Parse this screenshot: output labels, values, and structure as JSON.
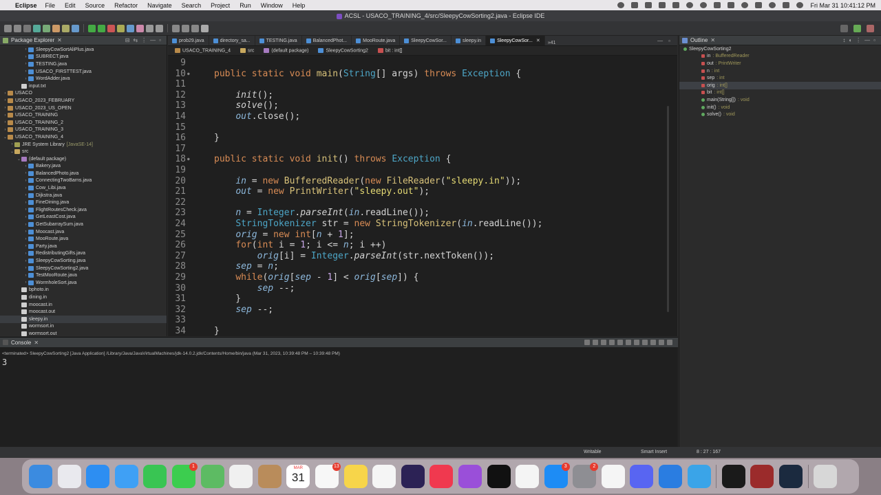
{
  "menubar": {
    "app_name": "Eclipse",
    "items": [
      "File",
      "Edit",
      "Source",
      "Refactor",
      "Navigate",
      "Search",
      "Project",
      "Run",
      "Window",
      "Help"
    ],
    "clock": "Fri Mar 31  10:41:12 PM"
  },
  "window": {
    "title": "ACSL - USACO_TRAINING_4/src/SleepyCowSorting2.java - Eclipse IDE"
  },
  "package_explorer": {
    "tab_label": "Package Explorer",
    "rows": [
      {
        "label": "SleepyCowSortAliPlus.java",
        "indent": 3,
        "icon": "java",
        "twisty": "›"
      },
      {
        "label": "SUBRECT.java",
        "indent": 3,
        "icon": "java",
        "twisty": "›"
      },
      {
        "label": "TESTING.java",
        "indent": 3,
        "icon": "java",
        "twisty": "›"
      },
      {
        "label": "USACO_FIRSTTEST.java",
        "indent": 3,
        "icon": "java",
        "twisty": "›"
      },
      {
        "label": "WordAdder.java",
        "indent": 3,
        "icon": "java",
        "twisty": "›"
      },
      {
        "label": "input.txt",
        "indent": 2,
        "icon": "file",
        "twisty": ""
      },
      {
        "label": "USACO",
        "indent": 0,
        "icon": "proj",
        "twisty": "›"
      },
      {
        "label": "USACO_2023_FEBRUARY",
        "indent": 0,
        "icon": "proj",
        "twisty": "›"
      },
      {
        "label": "USACO_2023_US_OPEN",
        "indent": 0,
        "icon": "proj",
        "twisty": "›"
      },
      {
        "label": "USACO_TRAINING",
        "indent": 0,
        "icon": "proj",
        "twisty": "›"
      },
      {
        "label": "USACO_TRAINING_2",
        "indent": 0,
        "icon": "proj",
        "twisty": "›"
      },
      {
        "label": "USACO_TRAINING_3",
        "indent": 0,
        "icon": "proj",
        "twisty": "›"
      },
      {
        "label": "USACO_TRAINING_4",
        "indent": 0,
        "icon": "proj",
        "twisty": "⌄"
      },
      {
        "label": "JRE System Library",
        "extra": "[JavaSE-14]",
        "indent": 1,
        "icon": "lib",
        "twisty": "›"
      },
      {
        "label": "src",
        "indent": 1,
        "icon": "folder",
        "twisty": "⌄"
      },
      {
        "label": "(default package)",
        "indent": 2,
        "icon": "pkg",
        "twisty": "⌄"
      },
      {
        "label": "Bakery.java",
        "indent": 3,
        "icon": "java",
        "twisty": "›"
      },
      {
        "label": "BalancedPhoto.java",
        "indent": 3,
        "icon": "java",
        "twisty": "›"
      },
      {
        "label": "ConnectingTwoBarns.java",
        "indent": 3,
        "icon": "java",
        "twisty": "›"
      },
      {
        "label": "Cow_Libi.java",
        "indent": 3,
        "icon": "java",
        "twisty": "›"
      },
      {
        "label": "Dijkstra.java",
        "indent": 3,
        "icon": "java",
        "twisty": "›"
      },
      {
        "label": "FineDining.java",
        "indent": 3,
        "icon": "java",
        "twisty": "›"
      },
      {
        "label": "FlightRoutesCheck.java",
        "indent": 3,
        "icon": "java",
        "twisty": "›"
      },
      {
        "label": "GetLeastCost.java",
        "indent": 3,
        "icon": "java",
        "twisty": "›"
      },
      {
        "label": "GetSubarraySum.java",
        "indent": 3,
        "icon": "java",
        "twisty": "›"
      },
      {
        "label": "Moocast.java",
        "indent": 3,
        "icon": "java",
        "twisty": "›"
      },
      {
        "label": "MooRoute.java",
        "indent": 3,
        "icon": "java",
        "twisty": "›"
      },
      {
        "label": "Party.java",
        "indent": 3,
        "icon": "java",
        "twisty": "›"
      },
      {
        "label": "RedistributingGifts.java",
        "indent": 3,
        "icon": "java",
        "twisty": "›"
      },
      {
        "label": "SleepyCowSorting.java",
        "indent": 3,
        "icon": "java",
        "twisty": "›"
      },
      {
        "label": "SleepyCowSorting2.java",
        "indent": 3,
        "icon": "java",
        "twisty": "›"
      },
      {
        "label": "TestMooRoute.java",
        "indent": 3,
        "icon": "java",
        "twisty": "›"
      },
      {
        "label": "WormholeSort.java",
        "indent": 3,
        "icon": "java",
        "twisty": "›"
      },
      {
        "label": "bphoto.in",
        "indent": 2,
        "icon": "file",
        "twisty": ""
      },
      {
        "label": "dining.in",
        "indent": 2,
        "icon": "file",
        "twisty": ""
      },
      {
        "label": "moocast.in",
        "indent": 2,
        "icon": "file",
        "twisty": ""
      },
      {
        "label": "moocast.out",
        "indent": 2,
        "icon": "file",
        "twisty": ""
      },
      {
        "label": "sleepy.in",
        "indent": 2,
        "icon": "file",
        "twisty": "",
        "selected": true
      },
      {
        "label": "wormsort.in",
        "indent": 2,
        "icon": "file",
        "twisty": ""
      },
      {
        "label": "wormsort.out",
        "indent": 2,
        "icon": "file",
        "twisty": ""
      }
    ]
  },
  "editor": {
    "tabs": [
      {
        "label": "prob29.java",
        "active": false
      },
      {
        "label": "directory_sa...",
        "active": false
      },
      {
        "label": "TESTING.java",
        "active": false
      },
      {
        "label": "BalancedPhot...",
        "active": false
      },
      {
        "label": "MooRoute.java",
        "active": false
      },
      {
        "label": "SleepyCowSor...",
        "active": false
      },
      {
        "label": "sleepy.in",
        "active": false
      },
      {
        "label": "SleepyCowSor...",
        "active": true
      }
    ],
    "overflow_label": "»41",
    "breadcrumb": [
      "USACO_TRAINING_4",
      "src",
      "(default package)",
      "SleepyCowSorting2",
      "bit : int[]"
    ],
    "lines": [
      {
        "n": "9",
        "html": ""
      },
      {
        "n": "10",
        "fold": true,
        "html": "<span class='kw'>public static void</span> <span class='fn'>main</span>(<span class='ty'>String</span>[] args) <span class='kw'>throws</span> <span class='ty'>Exception</span> {"
      },
      {
        "n": "11",
        "html": ""
      },
      {
        "n": "12",
        "html": "    <span class='sm'>init</span>();"
      },
      {
        "n": "13",
        "html": "    <span class='sm'>solve</span>();"
      },
      {
        "n": "14",
        "html": "    <span class='var'>out</span>.close();"
      },
      {
        "n": "15",
        "html": ""
      },
      {
        "n": "16",
        "html": "}"
      },
      {
        "n": "17",
        "html": ""
      },
      {
        "n": "18",
        "fold": true,
        "html": "<span class='kw'>public static void</span> <span class='fn'>init</span>() <span class='kw'>throws</span> <span class='ty'>Exception</span> {"
      },
      {
        "n": "19",
        "html": ""
      },
      {
        "n": "20",
        "html": "    <span class='var'>in</span> = <span class='kw'>new</span> <span class='fn'>BufferedReader</span>(<span class='kw'>new</span> <span class='fn'>FileReader</span>(<span class='str'>\"sleepy.in\"</span>));"
      },
      {
        "n": "21",
        "html": "    <span class='var'>out</span> = <span class='kw'>new</span> <span class='fn'>PrintWriter</span>(<span class='str'>\"sleepy.out\"</span>);"
      },
      {
        "n": "22",
        "html": ""
      },
      {
        "n": "23",
        "html": "    <span class='var'>n</span> = <span class='ty'>Integer</span>.<span class='sm'>parseInt</span>(<span class='var'>in</span>.readLine());"
      },
      {
        "n": "24",
        "html": "    <span class='ty'>StringTokenizer</span> str = <span class='kw'>new</span> <span class='fn'>StringTokenizer</span>(<span class='var'>in</span>.readLine());"
      },
      {
        "n": "25",
        "html": "    <span class='var'>orig</span> = <span class='kw'>new int</span>[<span class='var'>n</span> + <span class='num'>1</span>];"
      },
      {
        "n": "26",
        "html": "    <span class='kw'>for</span>(<span class='kw'>int</span> i = <span class='num'>1</span>; i &lt;= <span class='var'>n</span>; i ++)"
      },
      {
        "n": "27",
        "html": "        <span class='var'>orig</span>[i] = <span class='ty'>Integer</span>.<span class='sm'>parseInt</span>(str.nextToken());"
      },
      {
        "n": "28",
        "html": "    <span class='var'>sep</span> = <span class='var'>n</span>;"
      },
      {
        "n": "29",
        "html": "    <span class='kw'>while</span>(<span class='var'>orig</span>[<span class='var'>sep</span> - <span class='num'>1</span>] &lt; <span class='var'>orig</span>[<span class='var'>sep</span>]) {"
      },
      {
        "n": "30",
        "html": "        <span class='var'>sep</span> --;"
      },
      {
        "n": "31",
        "html": "    }"
      },
      {
        "n": "32",
        "html": "    <span class='var'>sep</span> --;"
      },
      {
        "n": "33",
        "html": ""
      },
      {
        "n": "34",
        "html": "}"
      }
    ]
  },
  "outline": {
    "tab_label": "Outline",
    "rows": [
      {
        "label": "SleepyCowSorting2",
        "type": "",
        "indent": 0,
        "dot": "class"
      },
      {
        "label": "in",
        "type": ": BufferedReader",
        "indent": 1,
        "dot": "red"
      },
      {
        "label": "out",
        "type": ": PrintWriter",
        "indent": 1,
        "dot": "red"
      },
      {
        "label": "n",
        "type": ": int",
        "indent": 1,
        "dot": "red"
      },
      {
        "label": "sep",
        "type": ": int",
        "indent": 1,
        "dot": "red"
      },
      {
        "label": "orig",
        "type": ": int[]",
        "indent": 1,
        "dot": "red",
        "selected": true
      },
      {
        "label": "bit",
        "type": ": int[]",
        "indent": 1,
        "dot": "red"
      },
      {
        "label": "main(String[])",
        "type": ": void",
        "indent": 1,
        "dot": "green"
      },
      {
        "label": "init()",
        "type": ": void",
        "indent": 1,
        "dot": "green"
      },
      {
        "label": "solve()",
        "type": ": void",
        "indent": 1,
        "dot": "green"
      }
    ]
  },
  "console": {
    "tab_label": "Console",
    "info": "<terminated> SleepyCowSorting2 [Java Application] /Library/Java/JavaVirtualMachines/jdk-14.0.2.jdk/Contents/Home/bin/java  (Mar 31, 2023, 10:39:48 PM – 10:39:48 PM)",
    "output": "3"
  },
  "status": {
    "writable": "Writable",
    "insert_mode": "Smart Insert",
    "position": "8 : 27 : 167"
  },
  "dock": {
    "calendar_month": "MAR",
    "calendar_day": "31",
    "apps": [
      {
        "name": "finder-icon",
        "color": "#3b8be0",
        "badge": ""
      },
      {
        "name": "launchpad-icon",
        "color": "#e9e9ee",
        "badge": ""
      },
      {
        "name": "safari-icon",
        "color": "#2d8ef2",
        "badge": ""
      },
      {
        "name": "mail-icon",
        "color": "#3fa0f5",
        "badge": ""
      },
      {
        "name": "facetime-icon",
        "color": "#39c553",
        "badge": ""
      },
      {
        "name": "messages-icon",
        "color": "#3ccd4f",
        "badge": "1"
      },
      {
        "name": "maps-icon",
        "color": "#5dbb63",
        "badge": ""
      },
      {
        "name": "photos-icon",
        "color": "#f0f0f0",
        "badge": ""
      },
      {
        "name": "contacts-icon",
        "color": "#b98c5b",
        "badge": ""
      },
      {
        "name": "calendar-icon",
        "color": "#ffffff",
        "badge": ""
      },
      {
        "name": "reminders-icon",
        "color": "#f7f7f7",
        "badge": "13"
      },
      {
        "name": "notes-icon",
        "color": "#f7d54a",
        "badge": ""
      },
      {
        "name": "freeform-icon",
        "color": "#f5f5f5",
        "badge": ""
      },
      {
        "name": "eclipse-icon",
        "color": "#2c2255",
        "badge": ""
      },
      {
        "name": "music-icon",
        "color": "#f0394f",
        "badge": ""
      },
      {
        "name": "podcasts-icon",
        "color": "#9a4fd9",
        "badge": ""
      },
      {
        "name": "tv-icon",
        "color": "#111111",
        "badge": ""
      },
      {
        "name": "news-icon",
        "color": "#f4f4f4",
        "badge": ""
      },
      {
        "name": "app-store-icon",
        "color": "#1d8cf5",
        "badge": "3"
      },
      {
        "name": "system-settings-icon",
        "color": "#8e8e93",
        "badge": "2"
      },
      {
        "name": "chrome-icon",
        "color": "#f5f5f5",
        "badge": ""
      },
      {
        "name": "discord-icon",
        "color": "#5865f2",
        "badge": ""
      },
      {
        "name": "tasks-icon",
        "color": "#2a7de1",
        "badge": ""
      },
      {
        "name": "app-icon",
        "color": "#3aa4e8",
        "badge": ""
      },
      {
        "name": "terminal-icon",
        "color": "#1a1a1a",
        "badge": ""
      },
      {
        "name": "dictionary-icon",
        "color": "#9b2b2b",
        "badge": ""
      },
      {
        "name": "steam-icon",
        "color": "#1b2a3f",
        "badge": ""
      },
      {
        "name": "trash-icon",
        "color": "#d7d7d7",
        "badge": ""
      }
    ]
  }
}
